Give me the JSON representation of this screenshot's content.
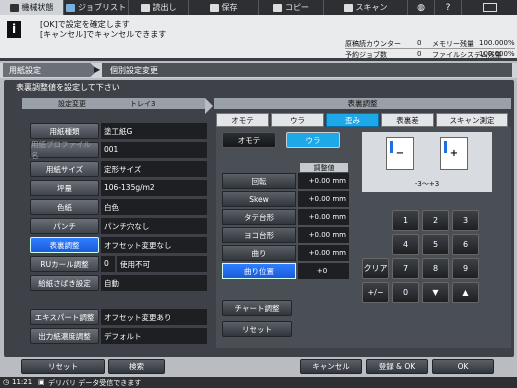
{
  "top_tabs": [
    {
      "label": "機械状態",
      "icon": "machine-icon"
    },
    {
      "label": "ジョブリスト",
      "icon": "job-list-icon"
    },
    {
      "label": "読出し",
      "icon": "recall-icon"
    },
    {
      "label": "保存",
      "icon": "save-icon"
    },
    {
      "label": "コピー",
      "icon": "copy-icon"
    },
    {
      "label": "スキャン",
      "icon": "scan-icon"
    }
  ],
  "message": {
    "line1": "[OK]で設定を確定します",
    "line2": "[キャンセル]でキャンセルできます"
  },
  "status": [
    {
      "label": "原稿読カウンター",
      "value": "0",
      "label2": "メモリー残量",
      "value2": "100.000%"
    },
    {
      "label": "予約ジョブ数",
      "value": "0",
      "label2": "ファイルシステム残量",
      "value2": "100.000%"
    }
  ],
  "breadcrumb": {
    "item1": "用紙設定",
    "item2": "個別設定変更"
  },
  "panel_title": "表裏調整値を設定して下さい",
  "left": {
    "header_left": "設定変更",
    "header_right": "トレイ3",
    "rows": [
      {
        "label": "用紙種類",
        "value": "塗工紙G"
      },
      {
        "label": "用紙プロファイル名",
        "value": "001"
      },
      {
        "label": "用紙サイズ",
        "value": "定形サイズ"
      },
      {
        "label": "坪量",
        "value": "106-135g/m2"
      },
      {
        "label": "色紙",
        "value": "白色"
      },
      {
        "label": "パンチ",
        "value": "パンチ穴なし"
      },
      {
        "label": "表裏調整",
        "value": "オフセット変更なし"
      },
      {
        "label": "RUカール調整",
        "value": "0",
        "value2": "使用不可"
      },
      {
        "label": "給紙さばき設定",
        "value": "自動"
      },
      {
        "label": "エキスパート調整",
        "value": "オフセット変更あり"
      },
      {
        "label": "出力紙濃度調整",
        "value": "デフォルト"
      }
    ]
  },
  "right": {
    "header": "表裏調整",
    "tabs": [
      "オモテ",
      "ウラ",
      "歪み",
      "表裏差",
      "スキャン測定"
    ],
    "side_front": "オモテ",
    "side_back": "ウラ",
    "value_header": "調整値",
    "rows": [
      {
        "label": "回転",
        "value": "+0.00",
        "unit": "mm"
      },
      {
        "label": "Skew",
        "value": "+0.00",
        "unit": "mm"
      },
      {
        "label": "タテ台形",
        "value": "+0.00",
        "unit": "mm"
      },
      {
        "label": "ヨコ台形",
        "value": "+0.00",
        "unit": "mm"
      },
      {
        "label": "曲り",
        "value": "+0.00",
        "unit": "mm"
      },
      {
        "label": "曲り位置",
        "value": "+0",
        "unit": ""
      }
    ],
    "chart_btn": "チャート調整",
    "reset_btn": "リセット",
    "preview_minus": "−",
    "preview_plus": "+",
    "range": "-3～+3",
    "keys": [
      "1",
      "2",
      "3",
      "4",
      "5",
      "6",
      "クリア",
      "7",
      "8",
      "9",
      "+/−",
      "0",
      "▼",
      "▲"
    ]
  },
  "bottom": {
    "reset": "リセット",
    "search": "検索",
    "cancel": "キャンセル",
    "register_ok": "登録 & OK",
    "ok": "OK"
  },
  "footer": {
    "time": "11:21",
    "message": "デリバリ データ受信できます"
  }
}
